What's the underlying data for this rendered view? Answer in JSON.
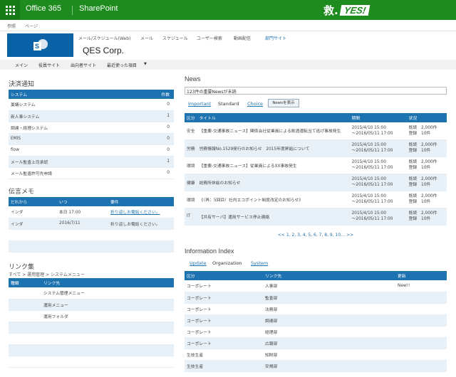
{
  "topbar": {
    "brand": "Office 365",
    "product": "SharePoint",
    "logo_kanji": "救.",
    "logo_yes": "YES!"
  },
  "subbar": {
    "items": [
      "参照",
      "ページ"
    ]
  },
  "topnav": {
    "items": [
      "メール/スケジュール(Web)",
      "メール",
      "スケジュール",
      "ユーザー検索",
      "動画配信",
      "部門サイト"
    ]
  },
  "site": {
    "title": "QES Corp."
  },
  "quicknav": {
    "items": [
      "メイン",
      "役員サイト",
      "出向者サイト",
      "最近使った項目"
    ]
  },
  "approval": {
    "title": "決済通知",
    "headers": [
      "システム",
      "件数"
    ],
    "rows": [
      [
        "稟議システム",
        "0"
      ],
      [
        "新人事システム",
        "1"
      ],
      [
        "調達・経理システム",
        "0"
      ],
      [
        "EMIS",
        "0"
      ],
      [
        "flow",
        "0"
      ],
      [
        "メール監査上司承認",
        "1"
      ],
      [
        "メール監査許可先申請",
        "0"
      ]
    ]
  },
  "memo": {
    "title": "伝言メモ",
    "headers": [
      "だれから",
      "いつ",
      "要件"
    ],
    "rows": [
      [
        "インダ",
        "本日 17:00",
        "折り返しお電話ください。"
      ],
      [
        "インダ",
        "2016/7/11",
        "折り返しお電話ください。"
      ]
    ]
  },
  "links": {
    "title": "リンク集",
    "breadcrumb": "すべて > 運用管理 > システムメニュー",
    "headers": [
      "種類",
      "リンク先"
    ],
    "rows": [
      [
        "",
        "システム管理メニュー"
      ],
      [
        "",
        "運用メニュー"
      ],
      [
        "",
        "運用フォルダ"
      ]
    ]
  },
  "news": {
    "title": "News",
    "input_value": "123件の重要Newsが未読",
    "tabs": [
      "Important",
      "Standard",
      "Choice"
    ],
    "button": "Newsを表示",
    "headers": [
      "区分",
      "タイトル",
      "期間",
      "状況"
    ],
    "rows": [
      {
        "cat": "安全",
        "title": "【重要-交通事故ニュース】関係会社従業員による飲酒運転当て逃げ事故発生",
        "period1": "2015/4/10 15:00",
        "period2": "～2016/05/11 17:00",
        "status1": "既読　2,000件",
        "status2": "登録　10件"
      },
      {
        "cat": "労務",
        "title": "労務情報No.1529発行のお知らせ　2015年度昇給について",
        "period1": "2015/4/10 15:00",
        "period2": "～2016/05/11 17:00",
        "status1": "既読　2,000件",
        "status2": "登録　10件"
      },
      {
        "cat": "環境",
        "title": "【重要-交通事故ニュース】従業員によるXX事故発生",
        "period1": "2015/4/10 15:00",
        "period2": "～2016/05/11 17:00",
        "status1": "既読　2,000件",
        "status2": "登録　10件"
      },
      {
        "cat": "健康",
        "title": "総務所休絵のお知らせ",
        "period1": "2015/4/10 15:00",
        "period2": "～2016/05/11 17:00",
        "status1": "既読　2,000件",
        "status2": "登録　10件"
      },
      {
        "cat": "環境",
        "title": "《（再：5回目）社内エコポイント制度改定のお知らせ》",
        "period1": "2015/4/10 15:00",
        "period2": "～2016/05/11 17:00",
        "status1": "既読　2,000件",
        "status2": "登録　10件"
      },
      {
        "cat": "IT",
        "title": "【共有サーバ】運用サービス停止連絡",
        "period1": "2015/4/10 15:00",
        "period2": "～2016/05/11 17:00",
        "status1": "既読　2,000件",
        "status2": "登録　10件"
      }
    ],
    "pager": "<< 1, 2, 3, 4, 5, 6, 7, 8, 9, 10… >>"
  },
  "info": {
    "title": "Information Index",
    "tabs": [
      "Update",
      "Organization",
      "System"
    ],
    "headers": [
      "区分",
      "リンク先",
      "更新"
    ],
    "rows": [
      [
        "コーポレート",
        "人事部",
        "New!!"
      ],
      [
        "コーポレート",
        "監査部",
        ""
      ],
      [
        "コーポレート",
        "法務部",
        ""
      ],
      [
        "コーポレート",
        "調達部",
        ""
      ],
      [
        "コーポレート",
        "経理部",
        ""
      ],
      [
        "コーポレート",
        "広報部",
        ""
      ],
      [
        "生技生産",
        "知財部",
        ""
      ],
      [
        "生技生産",
        "安規部",
        ""
      ]
    ]
  },
  "colors": {
    "brand_green": "#1d8b1d",
    "table_header_blue": "#1d72b0",
    "row_stripe": "#e9f1f8"
  }
}
